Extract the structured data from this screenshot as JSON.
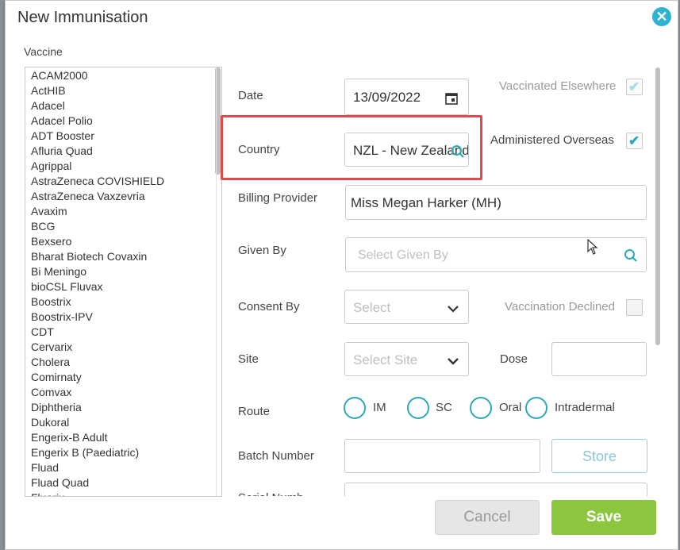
{
  "dialog": {
    "title": "New Immunisation",
    "close_icon": "close-icon"
  },
  "vaccine": {
    "label": "Vaccine",
    "items": [
      "ACAM2000",
      "ActHIB",
      "Adacel",
      "Adacel Polio",
      "ADT Booster",
      "Afluria Quad",
      "Agrippal",
      "AstraZeneca COVISHIELD",
      "AstraZeneca Vaxzevria",
      "Avaxim",
      "BCG",
      "Bexsero",
      "Bharat Biotech Covaxin",
      "Bi Meningo",
      "bioCSL Fluvax",
      "Boostrix",
      "Boostrix-IPV",
      "CDT",
      "Cervarix",
      "Cholera",
      "Comirnaty",
      "Comvax",
      "Diphtheria",
      "Dukoral",
      "Engerix-B Adult",
      "Engerix B (Paediatric)",
      "Fluad",
      "Fluad Quad",
      "Fluarix"
    ]
  },
  "form": {
    "date_label": "Date",
    "date_value": "13/09/2022",
    "vaccinated_elsewhere_label": "Vaccinated Elsewhere",
    "country_label": "Country",
    "country_value": "NZL - New Zealand",
    "administered_overseas_label": "Administered Overseas",
    "billing_provider_label": "Billing Provider",
    "billing_provider_value": "Miss Megan Harker (MH)",
    "given_by_label": "Given By",
    "given_by_placeholder": "Select Given By",
    "consent_by_label": "Consent By",
    "consent_by_placeholder": "Select",
    "vaccination_declined_label": "Vaccination Declined",
    "site_label": "Site",
    "site_placeholder": "Select Site",
    "dose_label": "Dose",
    "route_label": "Route",
    "route_options": [
      "IM",
      "SC",
      "Oral",
      "Intradermal"
    ],
    "batch_number_label": "Batch Number",
    "store_label": "Store",
    "serial_number_label": "Serial Numb"
  },
  "footer": {
    "cancel_label": "Cancel",
    "save_label": "Save"
  },
  "colors": {
    "accent": "#2eb3cf",
    "save": "#8cc63f",
    "highlight": "#e24b4b"
  }
}
